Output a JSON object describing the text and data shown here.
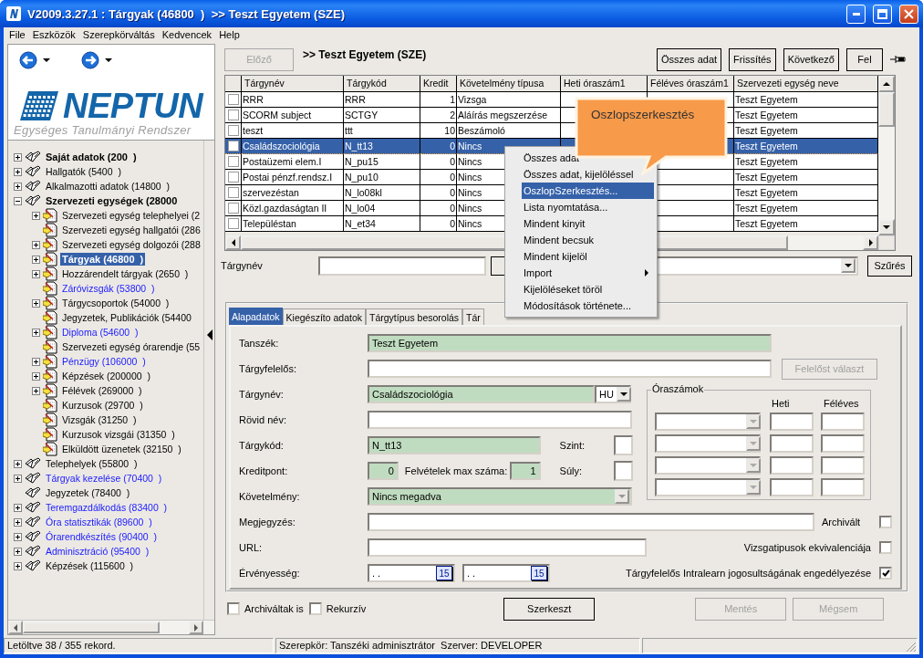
{
  "window": {
    "title": "V2009.3.27.1 : Tárgyak (46800  )  >> Teszt Egyetem (SZE)"
  },
  "menu_bar": [
    "File",
    "Eszközök",
    "Szerepkörváltás",
    "Kedvencek",
    "Help"
  ],
  "logo": {
    "name": "NEPTUN",
    "subtitle": "Egységes Tanulmányi Rendszer"
  },
  "tree": [
    {
      "label": "Saját adatok (200  )",
      "kind": "group",
      "expanded": false,
      "selected": false
    },
    {
      "label": "Hallgatók (5400  )",
      "kind": "book",
      "expanded": false,
      "selected": false
    },
    {
      "label": "Alkalmazotti adatok (14800  )",
      "kind": "book",
      "expanded": false,
      "selected": false
    },
    {
      "label": "Szervezeti egységek (28000",
      "kind": "group",
      "expanded": true,
      "selected": false,
      "children": [
        {
          "label": "Szervezeti egység telephelyei (2",
          "kind": "doc",
          "expanded": false,
          "selected": false
        },
        {
          "label": "Szervezeti egység hallgatói (286",
          "kind": "doc",
          "selected": false
        },
        {
          "label": "Szervezeti egység dolgozói (288",
          "kind": "doc",
          "expanded": false,
          "selected": false
        },
        {
          "label": "Tárgyak (46800  )",
          "kind": "doc",
          "expanded": false,
          "selected": true
        },
        {
          "label": "Hozzárendelt tárgyak (2650  )",
          "kind": "doc",
          "expanded": false,
          "selected": false
        },
        {
          "label": "Záróvizsgák (53800  )",
          "kind": "doclink",
          "selected": false
        },
        {
          "label": "Tárgycsoportok (54000  )",
          "kind": "doc",
          "expanded": false,
          "selected": false
        },
        {
          "label": "Jegyzetek, Publikációk (54400",
          "kind": "doc",
          "selected": false
        },
        {
          "label": "Diploma (54600  )",
          "kind": "doclink",
          "expanded": false,
          "selected": false
        },
        {
          "label": "Szervezeti egység órarendje (55",
          "kind": "doc",
          "selected": false
        },
        {
          "label": "Pénzügy (106000  )",
          "kind": "doclink",
          "expanded": false,
          "selected": false
        },
        {
          "label": "Képzések (200000  )",
          "kind": "doc",
          "expanded": false,
          "selected": false
        },
        {
          "label": "Félévek (269000  )",
          "kind": "doc",
          "expanded": false,
          "selected": false
        },
        {
          "label": "Kurzusok (29700  )",
          "kind": "doc",
          "selected": false
        },
        {
          "label": "Vizsgák (31250  )",
          "kind": "doc",
          "selected": false
        },
        {
          "label": "Kurzusok vizsgái (31350  )",
          "kind": "doc",
          "selected": false
        },
        {
          "label": "Elküldött üzenetek (32150  )",
          "kind": "doc",
          "selected": false
        }
      ]
    },
    {
      "label": "Telephelyek (55800  )",
      "kind": "book",
      "expanded": false,
      "selected": false
    },
    {
      "label": "Tárgyak kezelése (70400  )",
      "kind": "booklink",
      "expanded": false,
      "selected": false
    },
    {
      "label": "Jegyzetek (78400  )",
      "kind": "book",
      "selected": false
    },
    {
      "label": "Teremgazdálkodás (83400  )",
      "kind": "booklink",
      "expanded": false,
      "selected": false
    },
    {
      "label": "Óra statisztikák (89600  )",
      "kind": "booklink",
      "expanded": false,
      "selected": false
    },
    {
      "label": "Órarendkészítés (90400  )",
      "kind": "booklink",
      "expanded": false,
      "selected": false
    },
    {
      "label": "Adminisztráció (95400  )",
      "kind": "booklink",
      "expanded": false,
      "selected": false
    },
    {
      "label": "Képzések (115600  )",
      "kind": "book",
      "expanded": false,
      "selected": false
    }
  ],
  "toolbar": {
    "prev_button": {
      "label": "Előző",
      "disabled": true
    },
    "breadcrumb": ">> Teszt Egyetem (SZE)",
    "buttons": [
      "Összes adat",
      "Frissítés",
      "Következő",
      "Fel"
    ]
  },
  "table": {
    "columns": [
      "Tárgynév",
      "Tárgykód",
      "Kredit",
      "Követelmény típusa",
      "Heti óraszám1",
      "Féléves óraszám1",
      "Szervezeti egység neve"
    ],
    "rows": [
      {
        "name": "RRR",
        "code": "RRR",
        "credit": "1",
        "requirement": "Vizsga",
        "org_unit": "Teszt Egyetem",
        "checked": false,
        "selected": false
      },
      {
        "name": "SCORM subject",
        "code": "SCTGY",
        "credit": "2",
        "requirement": "Aláírás megszerzése",
        "org_unit": "Teszt Egyetem",
        "checked": false,
        "selected": false
      },
      {
        "name": "teszt",
        "code": "ttt",
        "credit": "10",
        "requirement": "Beszámoló",
        "org_unit": "Teszt Egyetem",
        "checked": false,
        "selected": false
      },
      {
        "name": "Családszociológia",
        "code": "N_tt13",
        "credit": "0",
        "requirement": "Nincs",
        "org_unit": "Teszt Egyetem",
        "checked": false,
        "selected": true
      },
      {
        "name": "Postaüzemi elem.I",
        "code": "N_pu15",
        "credit": "0",
        "requirement": "Nincs",
        "org_unit": "Teszt Egyetem",
        "checked": false,
        "selected": false
      },
      {
        "name": "Postai pénzf.rendsz.I",
        "code": "N_pu10",
        "credit": "0",
        "requirement": "Nincs",
        "org_unit": "Teszt Egyetem",
        "checked": false,
        "selected": false
      },
      {
        "name": "szervezéstan",
        "code": "N_lo08kl",
        "credit": "0",
        "requirement": "Nincs",
        "org_unit": "Teszt Egyetem",
        "checked": false,
        "selected": false
      },
      {
        "name": "Közl.gazdaságtan II",
        "code": "N_lo04",
        "credit": "0",
        "requirement": "Nincs",
        "org_unit": "Teszt Egyetem",
        "checked": false,
        "selected": false
      },
      {
        "name": "Településtan",
        "code": "N_et34",
        "credit": "0",
        "requirement": "Nincs",
        "org_unit": "Teszt Egyetem",
        "checked": false,
        "selected": false
      }
    ]
  },
  "filter": {
    "label": "Tárgynév",
    "button": "Szűrés"
  },
  "context_menu": [
    {
      "label": "Összes adat",
      "selected": false,
      "submenu": false
    },
    {
      "label": "Összes adat, kijelöléssel",
      "selected": false,
      "submenu": false
    },
    {
      "label": "OszlopSzerkesztés...",
      "selected": true,
      "submenu": false
    },
    {
      "label": "Lista nyomtatása...",
      "selected": false,
      "submenu": false
    },
    {
      "label": "Mindent kinyit",
      "selected": false,
      "submenu": false
    },
    {
      "label": "Mindent becsuk",
      "selected": false,
      "submenu": false
    },
    {
      "label": "Mindent kijelöl",
      "selected": false,
      "submenu": false
    },
    {
      "label": "Import",
      "selected": false,
      "submenu": true
    },
    {
      "label": "Kijelöléseket töröl",
      "selected": false,
      "submenu": false
    },
    {
      "label": "Módosítások története...",
      "selected": false,
      "submenu": false
    }
  ],
  "tooltip": "Oszlopszerkesztés",
  "tabs": [
    {
      "label": "Alapadatok",
      "selected": true
    },
    {
      "label": "Kiegészíto adatok",
      "selected": false
    },
    {
      "label": "Tárgytípus besorolás",
      "selected": false
    },
    {
      "label": "Tár",
      "selected": false
    }
  ],
  "form": {
    "department": {
      "label": "Tanszék:",
      "value": "Teszt Egyetem",
      "readonly": true
    },
    "responsible": {
      "label": "Tárgyfelelős:",
      "readonly": false,
      "button": {
        "label": "Felelőst választ",
        "disabled": true
      }
    },
    "subject_name": {
      "label": "Tárgynév:",
      "value": "Családszociológia",
      "readonly": true,
      "language": "HU"
    },
    "short_name": {
      "label": "Rövid név:",
      "readonly": false
    },
    "subject_code": {
      "label": "Tárgykód:",
      "value": "N_tt13",
      "readonly": true
    },
    "credit": {
      "label": "Kreditpont:",
      "value": "0",
      "readonly": true
    },
    "max_enrollments": {
      "label": "Felvételek max száma:",
      "value": "1",
      "readonly": true
    },
    "szint": {
      "label": "Szint:"
    },
    "weight": {
      "label": "Súly:"
    },
    "requirement": {
      "label": "Követelmény:",
      "value": "Nincs megadva",
      "readonly": true
    },
    "note": {
      "label": "Megjegyzés:",
      "readonly": false
    },
    "url": {
      "label": "URL:",
      "readonly": false
    },
    "validity": {
      "label": "Érvényesség:",
      "from": {
        "value": ". .",
        "button": "15"
      },
      "to": {
        "value": ". .",
        "button": "15"
      }
    },
    "hours": {
      "title": "Óraszámok",
      "columns": [
        "Heti",
        "Féléves"
      ],
      "rows": [
        {
          "disabled": true
        },
        {
          "disabled": true
        },
        {
          "disabled": true
        },
        {
          "disabled": true
        }
      ]
    },
    "checkboxes": [
      {
        "label": "Archivált",
        "checked": false
      },
      {
        "label": "Vizsgatipusok ekvivalenciája",
        "checked": false
      },
      {
        "label": "Tárgyfelelős Intralearn jogosultságának engedélyezése",
        "checked": true
      }
    ]
  },
  "footer": {
    "checkboxes": [
      {
        "label": "Archiváltak is",
        "checked": false
      },
      {
        "label": "Rekurzív",
        "checked": false
      }
    ],
    "buttons": [
      {
        "label": "Szerkeszt",
        "disabled": false
      },
      {
        "label": "Mentés",
        "disabled": true
      },
      {
        "label": "Mégsem",
        "disabled": true
      }
    ]
  },
  "status_bar": [
    "Letöltve 38 / 355 rekord.",
    "Szerepkör: Tanszéki adminisztrátor  Szerver: DEVELOPER"
  ]
}
